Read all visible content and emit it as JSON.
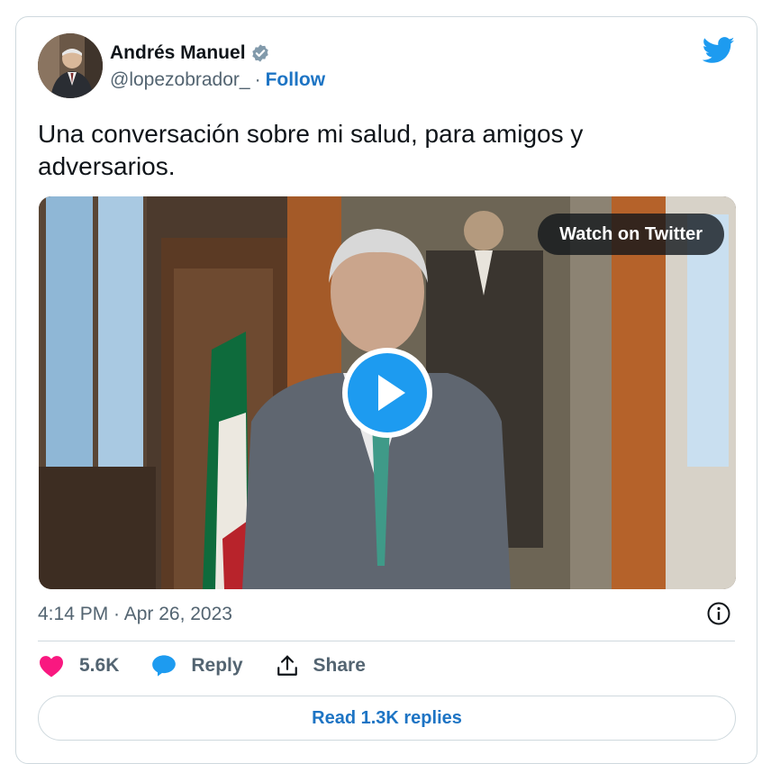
{
  "author": {
    "display_name": "Andrés Manuel",
    "handle": "@lopezobrador_",
    "separator": "·",
    "follow_label": "Follow",
    "verified": true
  },
  "tweet": {
    "text": "Una conversación sobre mi salud, para amigos y adversarios.",
    "timestamp": "4:14 PM · Apr 26, 2023"
  },
  "media": {
    "type": "video",
    "watch_label": "Watch on Twitter"
  },
  "actions": {
    "like_count": "5.6K",
    "reply_label": "Reply",
    "share_label": "Share"
  },
  "read_replies_label": "Read 1.3K replies",
  "colors": {
    "twitter_blue": "#1d9bf0",
    "link_blue": "#1d74c4",
    "like_pink": "#f91880",
    "muted": "#536471",
    "border": "#cfd9de"
  },
  "icons": [
    "verified-badge-icon",
    "twitter-bird-icon",
    "play-icon",
    "info-icon",
    "heart-icon",
    "reply-bubble-icon",
    "share-icon"
  ]
}
